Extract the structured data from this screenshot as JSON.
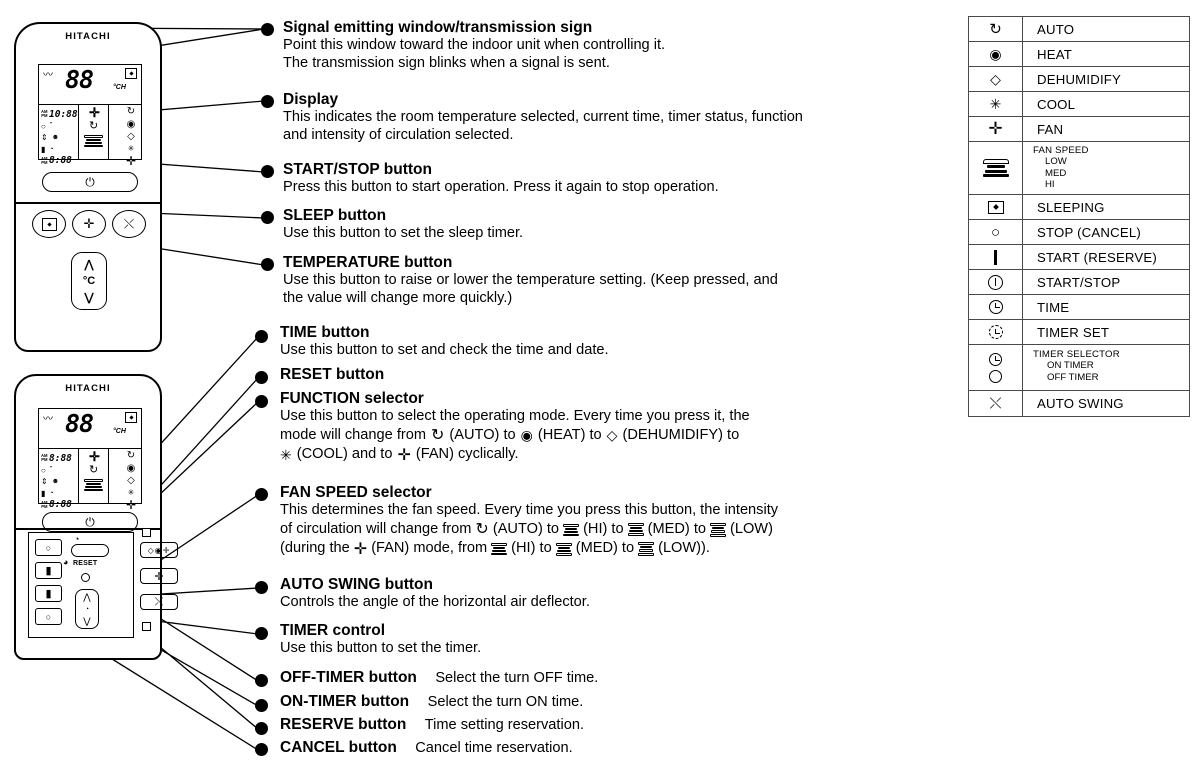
{
  "remote_top": {
    "brand": "HITACHI",
    "digits": "88",
    "ch_label": "°CH",
    "clock_top": "10:88",
    "clock_bottom": "8:88",
    "am": "AM",
    "pm": "PM"
  },
  "remote_bottom": {
    "brand": "HITACHI",
    "digits": "88",
    "ch_label": "°CH",
    "clock_top": "8:88",
    "clock_bottom": "8:88",
    "reset_label": "RESET"
  },
  "callouts": [
    {
      "title": "Signal emitting window/transmission sign",
      "lines": [
        "Point this window toward the indoor unit when controlling it.",
        "The transmission sign blinks when a signal is sent."
      ]
    },
    {
      "title": "Display",
      "lines": [
        "This indicates the room temperature selected, current time, timer status, function",
        "and intensity of circulation selected."
      ]
    },
    {
      "title": "START/STOP button",
      "lines": [
        "Press this button to start operation. Press it again to stop operation."
      ]
    },
    {
      "title": "SLEEP button",
      "lines": [
        "Use this button to set the sleep timer."
      ]
    },
    {
      "title": "TEMPERATURE button",
      "lines": [
        "Use this button to raise or lower the temperature setting. (Keep pressed, and",
        "the value will change more quickly.)"
      ]
    },
    {
      "title": "TIME button",
      "lines": [
        "Use this button to set and check the time and date."
      ]
    },
    {
      "title": "RESET button",
      "lines": []
    },
    {
      "title": "FUNCTION selector",
      "lines": [
        "Use this button to select the operating mode. Every time you press it, the",
        "mode will change from  ↻ (AUTO) to  ◉ (HEAT) to  ◇ (DEHUMIDIFY) to",
        "✳ (COOL) and to  ✛ (FAN) cyclically."
      ]
    },
    {
      "title": "FAN SPEED selector",
      "lines": [
        "This determines the fan speed. Every time you press this button, the intensity",
        "of circulation will change from ↻ (AUTO) to  (HI) to  (MED) to  (LOW)",
        "(during the ✛ (FAN) mode, from  (HI) to  (MED) to  (LOW))."
      ]
    },
    {
      "title": "AUTO SWING button",
      "lines": [
        "Controls the angle of the horizontal air deflector."
      ]
    },
    {
      "title": "TIMER control",
      "lines": [
        "Use this button to set the timer."
      ]
    },
    {
      "title": "OFF-TIMER button",
      "inline": "Select the turn OFF time.",
      "lines": []
    },
    {
      "title": "ON-TIMER button",
      "inline": "Select the turn ON time.",
      "lines": []
    },
    {
      "title": "RESERVE button",
      "inline": "Time setting reservation.",
      "lines": []
    },
    {
      "title": "CANCEL button",
      "inline": "Cancel time reservation.",
      "lines": []
    }
  ],
  "function_text": {
    "line1": "Use this button to select the operating mode. Every time you press it, the",
    "l2a": "mode will change from",
    "l2b": "(AUTO) to",
    "l2c": "(HEAT) to",
    "l2d": "(DEHUMIDIFY) to",
    "l3a": "(COOL) and to",
    "l3b": "(FAN) cyclically."
  },
  "fanspeed_text": {
    "line1": "This determines the fan speed. Every time you press this button, the intensity",
    "l2a": "of circulation will change from",
    "l2b": "(AUTO) to",
    "l2c": "(HI) to",
    "l2d": "(MED) to",
    "l2e": "(LOW)",
    "l3a": "(during the",
    "l3b": "(FAN) mode, from",
    "l3c": "(HI) to",
    "l3d": "(MED) to",
    "l3e": "(LOW))."
  },
  "legend": {
    "rows": [
      {
        "icon": "auto-cycle-icon",
        "glyph": "↻",
        "label": "AUTO"
      },
      {
        "icon": "heat-icon",
        "glyph": "◉",
        "label": "HEAT"
      },
      {
        "icon": "dehumidify-drop-icon",
        "glyph": "◇",
        "label": "DEHUMIDIFY"
      },
      {
        "icon": "snowflake-icon",
        "glyph": "✳",
        "label": "COOL"
      },
      {
        "icon": "fan-propeller-icon",
        "glyph": "✛",
        "label": "FAN"
      },
      {
        "icon": "fan-speed-icon",
        "glyph": "",
        "label": "FAN SPEED",
        "sub": [
          "LOW",
          "MED",
          "HI"
        ]
      },
      {
        "icon": "sleeping-icon",
        "glyph": "",
        "label": "SLEEPING"
      },
      {
        "icon": "stop-circle-icon",
        "glyph": "○",
        "label": "STOP (CANCEL)"
      },
      {
        "icon": "start-bar-icon",
        "glyph": "▮",
        "label": "START (RESERVE)"
      },
      {
        "icon": "power-icon",
        "glyph": "",
        "label": "START/STOP"
      },
      {
        "icon": "clock-icon",
        "glyph": "",
        "label": "TIME"
      },
      {
        "icon": "timer-set-icon",
        "glyph": "",
        "label": "TIMER SET"
      },
      {
        "icon": "timer-selector-icon",
        "glyph": "",
        "label": "TIMER SELECTOR",
        "sub": [
          "ON TIMER",
          "OFF TIMER"
        ]
      },
      {
        "icon": "auto-swing-icon",
        "glyph": "⤬",
        "label": "AUTO SWING"
      }
    ]
  }
}
